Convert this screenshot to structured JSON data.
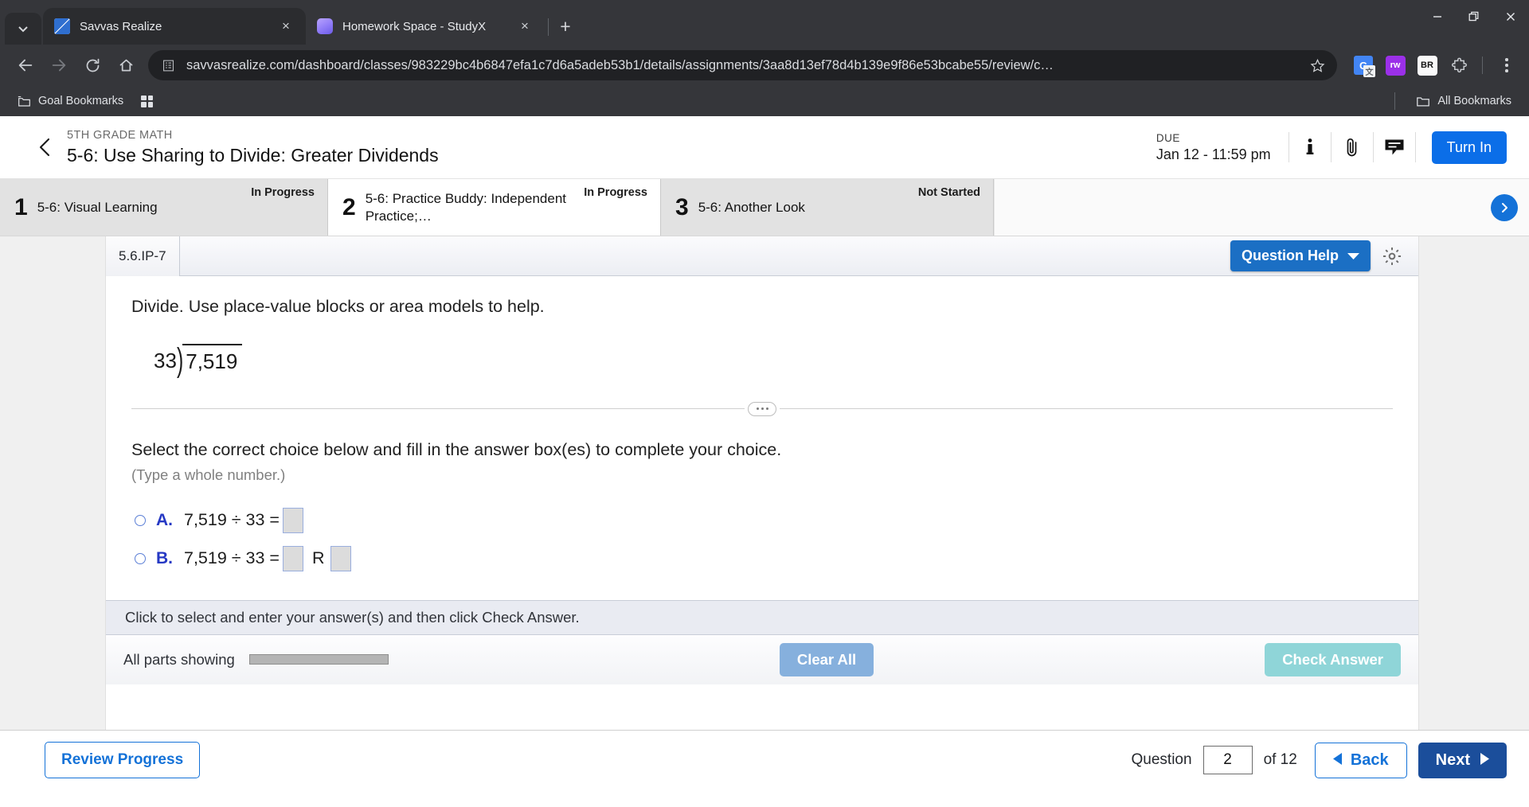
{
  "browser": {
    "tabs": [
      {
        "title": "Savvas Realize",
        "favicon": "savvas-icon",
        "active": true
      },
      {
        "title": "Homework Space - StudyX",
        "favicon": "studyx-icon",
        "active": false
      }
    ],
    "new_tab_label": "+",
    "close_label": "×",
    "url": "savvasrealize.com/dashboard/classes/983229bc4b6847efa1c7d6a5adeb53b1/details/assignments/3aa8d13ef78d4b139e9f86e53bcabe55/review/c…",
    "extensions": [
      {
        "name": "google-translate-extension",
        "label": "G"
      },
      {
        "name": "read-write-extension",
        "label": "rw"
      },
      {
        "name": "br-extension",
        "label": "BR"
      },
      {
        "name": "extensions-puzzle-icon",
        "label": ""
      }
    ],
    "bookmarks": {
      "folder_label": "Goal Bookmarks",
      "all_bookmarks_label": "All Bookmarks"
    }
  },
  "assignment": {
    "eyebrow": "5TH GRADE MATH",
    "title": "5-6: Use Sharing to Divide: Greater Dividends",
    "due_label": "DUE",
    "due_value": "Jan 12 - 11:59 pm",
    "turn_in_label": "Turn In",
    "accent_color": "#0b6ee8"
  },
  "steps": [
    {
      "num": "1",
      "label": "5-6: Visual Learning",
      "status": "In Progress",
      "state": "done"
    },
    {
      "num": "2",
      "label": "5-6: Practice Buddy: Independent Practice;…",
      "status": "In Progress",
      "state": "current"
    },
    {
      "num": "3",
      "label": "5-6: Another Look",
      "status": "Not Started",
      "state": "done"
    }
  ],
  "question": {
    "id": "5.6.IP-7",
    "help_label": "Question Help",
    "prompt": "Divide. Use place-value blocks or area models to help.",
    "long_division": {
      "divisor": "33",
      "dividend": "7,519"
    },
    "select_instruction": "Select the correct choice below and fill in the answer box(es) to complete your choice.",
    "type_hint": "(Type a whole number.)",
    "choices": [
      {
        "letter": "A.",
        "expr": "7,519 ÷ 33 =",
        "boxes": 1,
        "remainder_label": ""
      },
      {
        "letter": "B.",
        "expr": "7,519 ÷ 33 =",
        "boxes": 2,
        "remainder_label": "R"
      }
    ],
    "hint_bar": "Click to select and enter your answer(s) and then click Check Answer.",
    "all_parts_label": "All parts showing",
    "clear_all_label": "Clear All",
    "check_answer_label": "Check Answer"
  },
  "footer": {
    "review_progress_label": "Review Progress",
    "question_label": "Question",
    "question_number": "2",
    "of_label": "of 12",
    "back_label": "Back",
    "next_label": "Next"
  }
}
